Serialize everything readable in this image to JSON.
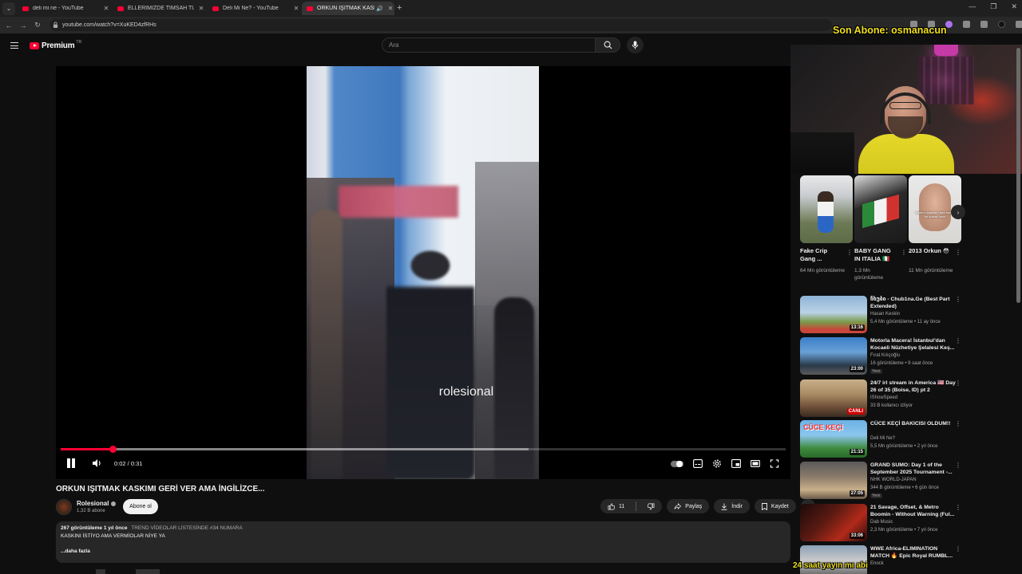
{
  "browser": {
    "tabs": [
      {
        "title": "deli mi ne - YouTube",
        "active": false
      },
      {
        "title": "ELLERİMİZDE TİMSAH TUTTUK",
        "active": false
      },
      {
        "title": "Deli Mi Ne? - YouTube",
        "active": false
      },
      {
        "title": "ORKUN IŞITMAK KASKIMI",
        "active": true
      }
    ],
    "new_tab": "+",
    "url": "youtube.com/watch?v=XuKED4zfRHs"
  },
  "youtube": {
    "logo_text": "Premium",
    "region": "TR",
    "search_placeholder": "Ara"
  },
  "player": {
    "watermark": "rolesional",
    "time": "0:02 / 0:31",
    "progress_played": 0.072,
    "progress_buffered": 0.645
  },
  "video": {
    "title": "ORKUN IŞITMAK KASKIMI GERİ VER AMA İNGİLİZCE...",
    "channel": "Rolesional",
    "subscribers": "1,32 B abone",
    "subscribe_label": "Abone ol",
    "like_count": "11",
    "share_label": "Paylaş",
    "download_label": "İndir",
    "save_label": "Kaydet",
    "description": {
      "views_date": "267 görüntüleme  1 yıl önce",
      "trend": "TREND VİDEOLAR LİSTESİNDE #34 NUMARA",
      "text": "KASKINI İSTİYO AMA VERMİOLAR NİYE YA",
      "more": "...daha fazla"
    }
  },
  "overlays": {
    "top": "Son Abone: osmanacun",
    "bottom": "24 saat yayın mı abi"
  },
  "shorts": [
    {
      "title": "Fake Crip Gang ...",
      "views": "64 Mn görüntüleme"
    },
    {
      "title": "BABY GANG IN ITALIA 🇮🇹",
      "views": "1,3 Mn görüntüleme"
    },
    {
      "title": "2013 Orkun 😳",
      "views": "11 Mn görüntüleme"
    }
  ],
  "shorts_thumb_texts": [
    "Allahım inşallah hiçbi basan bu dualar Amin"
  ],
  "recommendations": [
    {
      "title": "ჩხუბი - Chub1na.Ge (Best Part Extended)",
      "channel": "Hasan Keskin",
      "meta": "5,4 Mn görüntüleme • 11 ay önce",
      "duration": "13:16",
      "badge": ""
    },
    {
      "title": "Motorla Macera! İstanbul'dan Kocaeli Nüzhetiye Şelalesi Keş...",
      "channel": "Fırat Kılıçoğlu",
      "meta": "16 görüntüleme • 9 saat önce",
      "duration": "23:00",
      "badge": "Yeni"
    },
    {
      "title": "24/7 irl stream in America 🇺🇸 Day 26 of 35 (Boise, ID) pt 2",
      "channel": "IShowSpeed",
      "meta": "33 B kullanıcı izliyor",
      "duration": "CANLI",
      "badge": ""
    },
    {
      "title": "CÜCE KEÇİ BAKICISI OLDUM!!",
      "channel": "Deli Mi Ne?",
      "meta": "5,5 Mn görüntüleme • 2 yıl önce",
      "duration": "21:15",
      "badge": ""
    },
    {
      "title": "GRAND SUMO: Day 1 of the September 2025 Tournament -...",
      "channel": "NHK WORLD-JAPAN",
      "meta": "344 B görüntüleme • 6 gün önce",
      "duration": "27:05",
      "badge": "Yeni"
    },
    {
      "title": "21 Savage, Offset, & Metro Boomin - Without Warning (Ful...",
      "channel": "Dab Music",
      "meta": "2,3 Mn görüntüleme • 7 yıl önce",
      "duration": "33:06",
      "badge": ""
    },
    {
      "title": "WWE Africa-ELIMINATION MATCH 🔥 Epic Royal RUMBL...",
      "channel": "Enock",
      "meta": "",
      "duration": "",
      "badge": ""
    }
  ],
  "rec_thumb_texts": [
    "CÜCE KEÇİ"
  ]
}
